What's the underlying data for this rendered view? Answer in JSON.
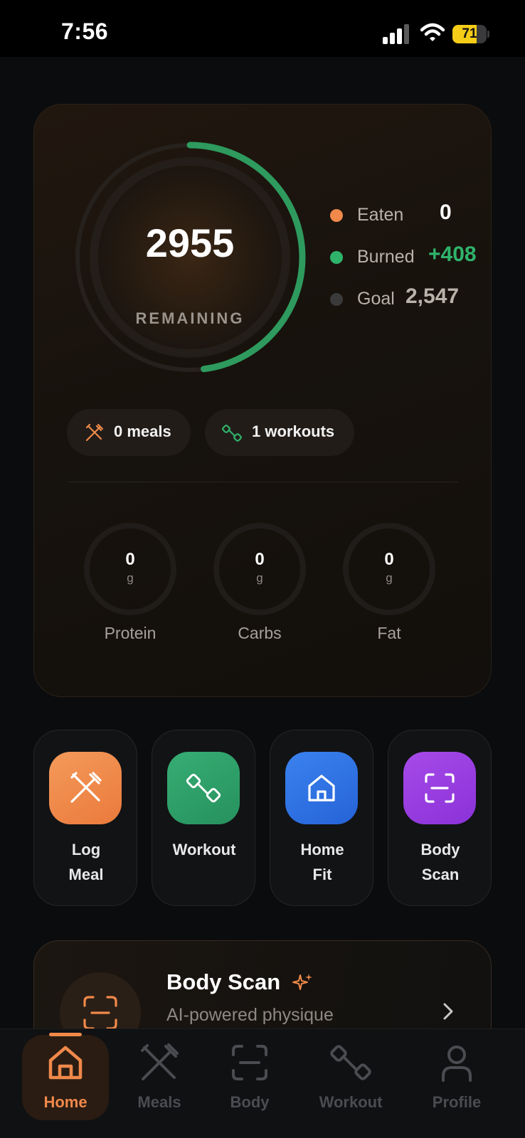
{
  "status_bar": {
    "time": "7:56",
    "battery_percent": "71",
    "battery_level": 0.71
  },
  "calories": {
    "remaining_value": "2955",
    "remaining_label": "REMAINING",
    "progress_fraction": 0.48,
    "colors": {
      "progress": "#2e9a5e",
      "eaten": "#f0894a",
      "burned": "#2fb36b",
      "goal": "#3a3a3a"
    },
    "legend": [
      {
        "label": "Eaten",
        "value": "0"
      },
      {
        "label": "Burned",
        "value": "+408"
      },
      {
        "label": "Goal",
        "value": "2,547"
      }
    ]
  },
  "chips": {
    "meals": "0 meals",
    "workouts": "1 workouts"
  },
  "macros": [
    {
      "value": "0",
      "unit": "g",
      "label": "Protein"
    },
    {
      "value": "0",
      "unit": "g",
      "label": "Carbs"
    },
    {
      "value": "0",
      "unit": "g",
      "label": "Fat"
    }
  ],
  "quick_actions": [
    {
      "line1": "Log",
      "line2": "Meal",
      "color": "#f0894a"
    },
    {
      "line1": "Workout",
      "line2": "",
      "color": "#2f9e68"
    },
    {
      "line1": "Home",
      "line2": "Fit",
      "color": "#2f6fe0"
    },
    {
      "line1": "Body",
      "line2": "Scan",
      "color": "#9b3fe0"
    }
  ],
  "body_scan_card": {
    "title": "Body Scan",
    "subtitle": "AI-powered physique"
  },
  "tabs": [
    {
      "label": "Home",
      "icon": "home-icon",
      "active": true
    },
    {
      "label": "Meals",
      "icon": "fork-knife-icon",
      "active": false
    },
    {
      "label": "Body",
      "icon": "scan-icon",
      "active": false
    },
    {
      "label": "Workout",
      "icon": "dumbbell-icon",
      "active": false
    },
    {
      "label": "Profile",
      "icon": "person-icon",
      "active": false
    }
  ],
  "accent_color": "#f0894a"
}
